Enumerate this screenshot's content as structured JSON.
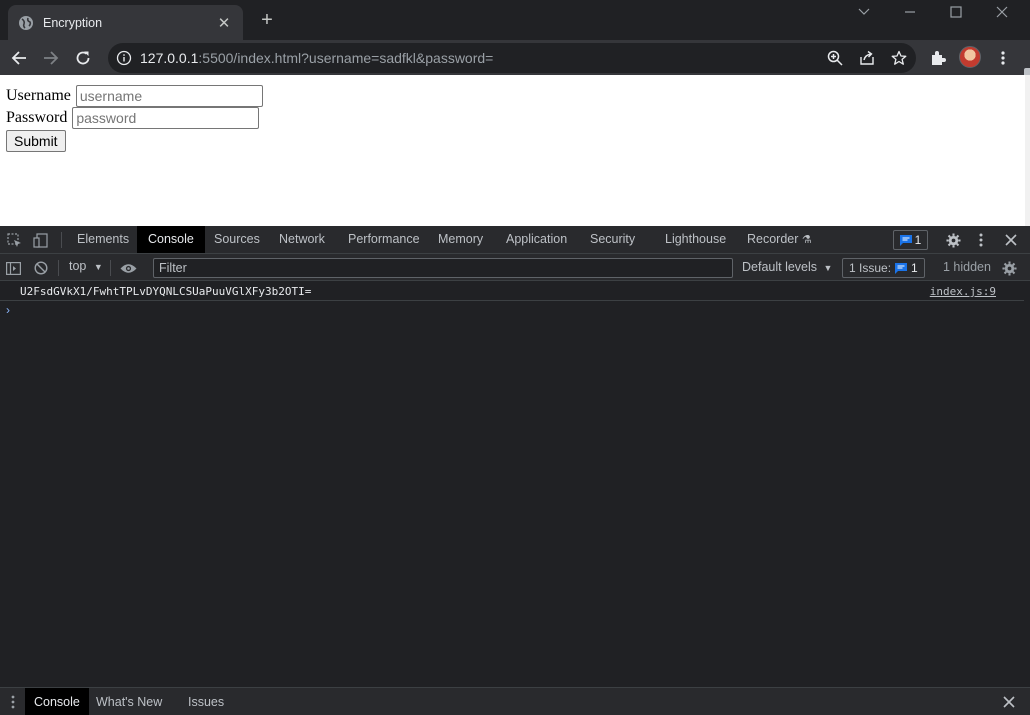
{
  "browser": {
    "tab_title": "Encryption",
    "url_host": "127.0.0.1",
    "url_rest": ":5500/index.html?username=sadfkl&password="
  },
  "page": {
    "username_label": "Username",
    "username_placeholder": "username",
    "password_label": "Password",
    "password_placeholder": "password",
    "submit_label": "Submit"
  },
  "devtools": {
    "tabs": [
      "Elements",
      "Console",
      "Sources",
      "Network",
      "Performance",
      "Memory",
      "Application",
      "Security",
      "Lighthouse",
      "Recorder"
    ],
    "active_tab": "Console",
    "issue_badge_count": "1",
    "context": "top",
    "filter_placeholder": "Filter",
    "levels_label": "Default levels",
    "issues_label": "1 Issue:",
    "issues_count": "1",
    "hidden_label": "1 hidden",
    "log": {
      "message": "U2FsdGVkX1/FwhtTPLvDYQNLCSUaPuuVGlXFy3b2OTI=",
      "source": "index.js:9"
    },
    "drawer_tabs": [
      "Console",
      "What's New",
      "Issues"
    ]
  },
  "colors": {
    "accent_blue": "#1a73e8",
    "prompt_blue": "#8ab4f8"
  }
}
